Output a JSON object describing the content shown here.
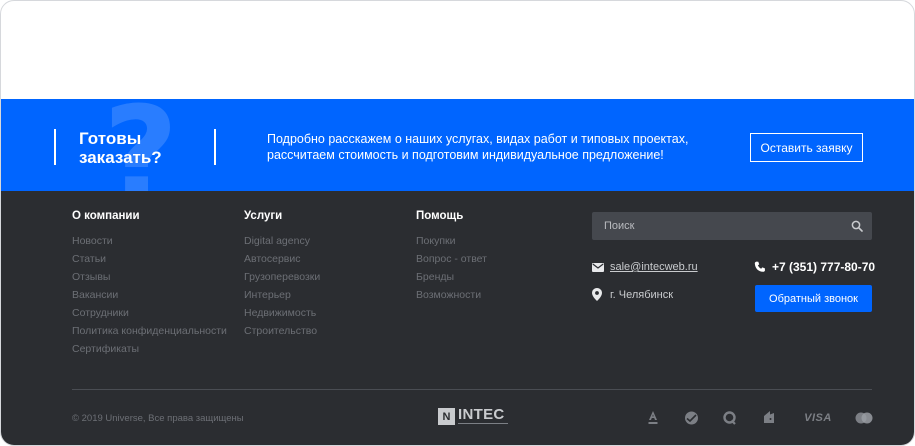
{
  "cta": {
    "title": "Готовы заказать?",
    "description": "Подробно расскажем о наших услугах, видах работ и типовых проектах, рассчитаем стоимость и подготовим индивидуальное предложение!",
    "button_label": "Оставить заявку"
  },
  "footer": {
    "columns": [
      {
        "heading": "О компании",
        "links": [
          "Новости",
          "Статьи",
          "Отзывы",
          "Вакансии",
          "Сотрудники",
          "Политика конфиденциальности",
          "Сертификаты"
        ]
      },
      {
        "heading": "Услуги",
        "links": [
          "Digital agency",
          "Автосервис",
          "Грузоперевозки",
          "Интерьер",
          "Недвижимость",
          "Строительство"
        ]
      },
      {
        "heading": "Помощь",
        "links": [
          "Покупки",
          "Вопрос - ответ",
          "Бренды",
          "Возможности"
        ]
      }
    ],
    "search": {
      "placeholder": "Поиск",
      "icon": "search-icon"
    },
    "contacts": {
      "email": "sale@intecweb.ru",
      "city": "г. Челябинск",
      "phone": "+7 (351) 777-80-70",
      "callback_label": "Обратный звонок"
    },
    "copyright": "© 2019 Universe, Все права защищены",
    "logo": {
      "name": "INTEC",
      "mark": "N"
    },
    "payments": [
      {
        "id": "alfa",
        "icon": "alfa-bank-icon"
      },
      {
        "id": "sber",
        "icon": "sberbank-icon"
      },
      {
        "id": "qiwi",
        "icon": "qiwi-icon"
      },
      {
        "id": "yandex",
        "icon": "yandex-money-icon"
      },
      {
        "id": "visa",
        "label": "VISA"
      },
      {
        "id": "mastercard",
        "icon": "mastercard-icon"
      }
    ]
  },
  "colors": {
    "accent": "#0065ff",
    "footer_bg": "#2b2d31",
    "link": "#6c6f75"
  }
}
